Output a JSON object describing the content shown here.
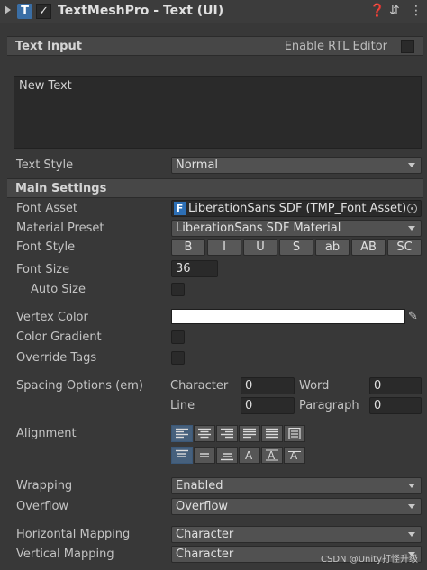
{
  "header": {
    "title": "TextMeshPro - Text (UI)",
    "enabled": true,
    "icons": [
      "text-component-icon",
      "help-icon",
      "presets-icon",
      "more-menu-icon"
    ]
  },
  "text_input": {
    "section_title": "Text Input",
    "rtl_label": "Enable RTL Editor",
    "rtl_enabled": false,
    "value": "New Text",
    "text_style_label": "Text Style",
    "text_style_value": "Normal"
  },
  "main_settings": {
    "section_title": "Main Settings",
    "font_asset_label": "Font Asset",
    "font_asset_value": "LiberationSans SDF (TMP_Font Asset)",
    "material_preset_label": "Material Preset",
    "material_preset_value": "LiberationSans SDF Material",
    "font_style_label": "Font Style",
    "font_style_buttons": [
      "B",
      "I",
      "U",
      "S",
      "ab",
      "AB",
      "SC"
    ],
    "font_size_label": "Font Size",
    "font_size_value": "36",
    "auto_size_label": "Auto Size",
    "auto_size": false,
    "vertex_color_label": "Vertex Color",
    "vertex_color": "#ffffff",
    "color_gradient_label": "Color Gradient",
    "color_gradient": false,
    "override_tags_label": "Override Tags",
    "override_tags": false,
    "spacing_label": "Spacing Options (em)",
    "spacing": {
      "character_label": "Character",
      "character_value": "0",
      "word_label": "Word",
      "word_value": "0",
      "line_label": "Line",
      "line_value": "0",
      "paragraph_label": "Paragraph",
      "paragraph_value": "0"
    },
    "alignment_label": "Alignment",
    "horizontal_alignment_active": "left",
    "vertical_alignment_active": "top",
    "wrapping_label": "Wrapping",
    "wrapping_value": "Enabled",
    "overflow_label": "Overflow",
    "overflow_value": "Overflow",
    "horizontal_mapping_label": "Horizontal Mapping",
    "horizontal_mapping_value": "Character",
    "vertical_mapping_label": "Vertical Mapping",
    "vertical_mapping_value": "Character"
  },
  "watermark": "CSDN @Unity打怪升级"
}
